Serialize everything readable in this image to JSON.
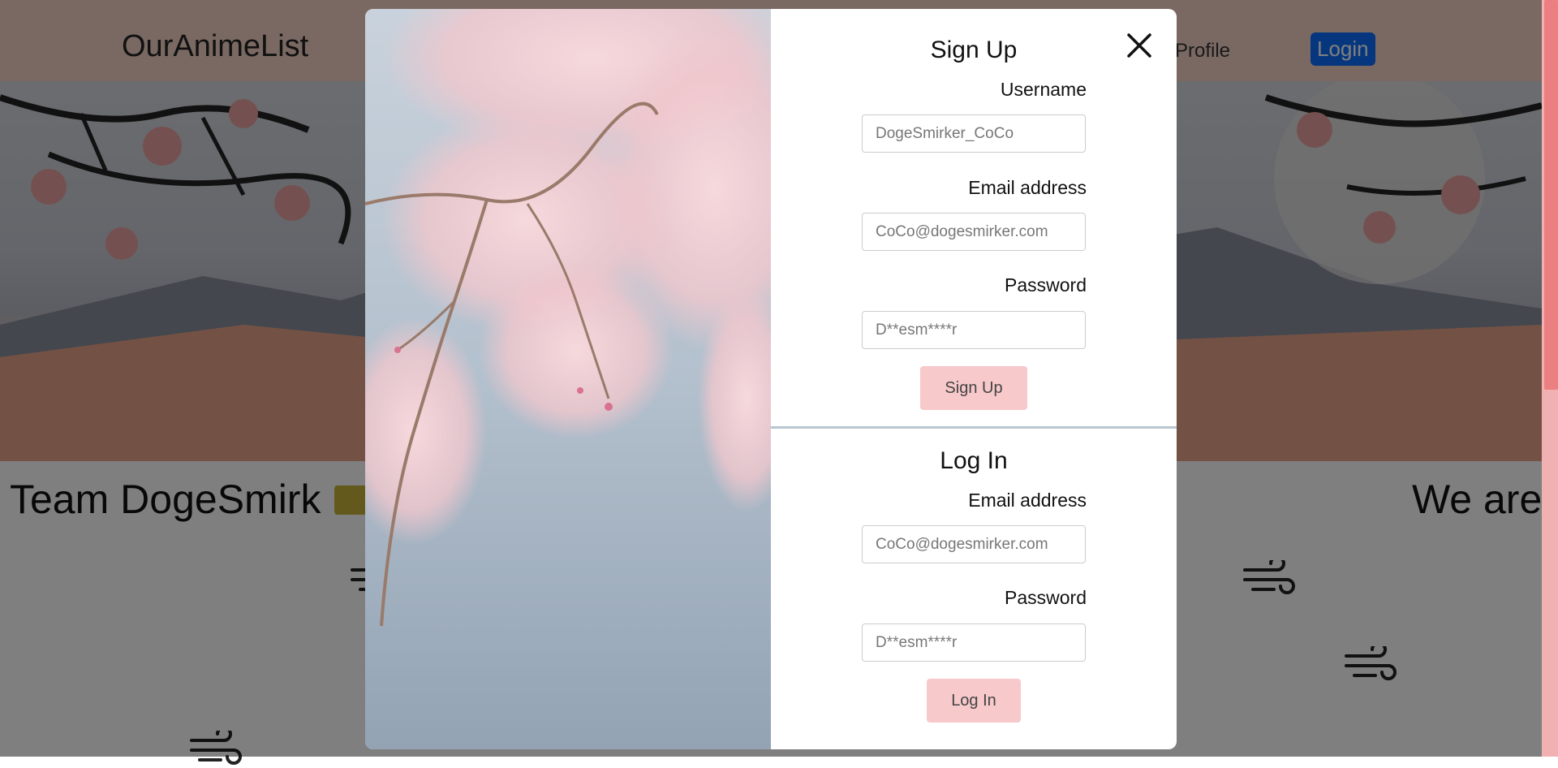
{
  "background": {
    "brand": "OurAnimeList",
    "nav": {
      "profile": "Profile",
      "login": "Login"
    },
    "team_title": "Team DogeSmirk",
    "we_are": "We are"
  },
  "modal": {
    "close_icon": "close-icon",
    "signup": {
      "title": "Sign Up",
      "username_label": "Username",
      "username_placeholder": "DogeSmirker_CoCo",
      "email_label": "Email address",
      "email_placeholder": "CoCo@dogesmirker.com",
      "password_label": "Password",
      "password_placeholder": "D**esm****r",
      "submit": "Sign Up"
    },
    "login": {
      "title": "Log In",
      "email_label": "Email address",
      "email_placeholder": "CoCo@dogesmirker.com",
      "password_label": "Password",
      "password_placeholder": "D**esm****r",
      "submit": "Log In"
    }
  },
  "colors": {
    "button_pink": "#f7c9cb",
    "divider": "#b9c6d2",
    "nav_login": "#0d6efd"
  }
}
